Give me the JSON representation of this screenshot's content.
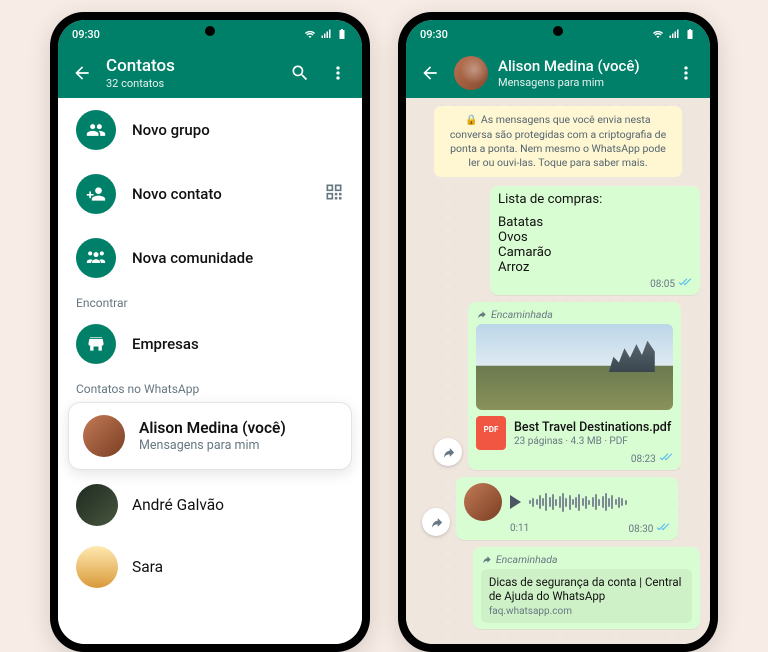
{
  "status": {
    "time": "09:30"
  },
  "phoneA": {
    "appbar": {
      "title": "Contatos",
      "subtitle": "32 contatos"
    },
    "actions": {
      "new_group": "Novo grupo",
      "new_contact": "Novo contato",
      "new_community": "Nova comunidade"
    },
    "sections": {
      "find": "Encontrar",
      "businesses": "Empresas",
      "contacts_on": "Contatos no WhatsApp"
    },
    "contacts": {
      "alison": {
        "name": "Alison Medina (você)",
        "sub": "Mensagens para mim"
      },
      "andre": {
        "name": "André Galvão"
      },
      "sara": {
        "name": "Sara"
      }
    }
  },
  "phoneB": {
    "appbar": {
      "title": "Alison Medina (você)",
      "subtitle": "Mensagens para mim"
    },
    "e2e": "As mensagens que você envia nesta conversa são protegidas com a criptografia de ponta a ponta. Nem mesmo o WhatsApp pode ler ou ouvi-las. Toque para saber mais.",
    "forwarded": "Encaminhada",
    "msg1": {
      "l1": "Lista de compras:",
      "l2": "Batatas",
      "l3": "Ovos",
      "l4": "Camarão",
      "l5": "Arroz",
      "time": "08:05"
    },
    "attachment": {
      "name": "Best Travel Destinations.pdf",
      "meta": "23 páginas · 4.3 MB · PDF",
      "time": "08:23"
    },
    "voice": {
      "duration": "0:11",
      "time": "08:30"
    },
    "link": {
      "title": "Dicas de segurança da conta | Central de Ajuda do WhatsApp",
      "host": "faq.whatsapp.com"
    }
  }
}
